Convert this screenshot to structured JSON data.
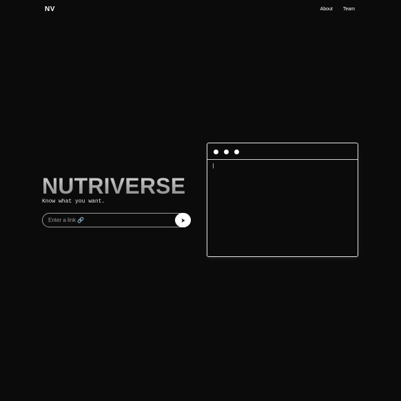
{
  "header": {
    "logo": "NV",
    "nav": [
      {
        "label": "About"
      },
      {
        "label": "Team"
      }
    ]
  },
  "hero": {
    "title": "NUTRIVERSE",
    "subtitle": "Know what you want.",
    "input": {
      "placeholder": "Enter a link 🔗",
      "value": ""
    },
    "submit_icon": "arrow-right-icon"
  },
  "terminal": {
    "dots": [
      "circle-icon",
      "circle-icon",
      "circle-icon"
    ],
    "prompt_cursor": "|"
  },
  "colors": {
    "background": "#0b0b0b",
    "text": "#ffffff",
    "title_gradient_top": "#dcdcdc",
    "title_gradient_bottom": "#8a8a8a",
    "border": "#e6e6e6"
  }
}
